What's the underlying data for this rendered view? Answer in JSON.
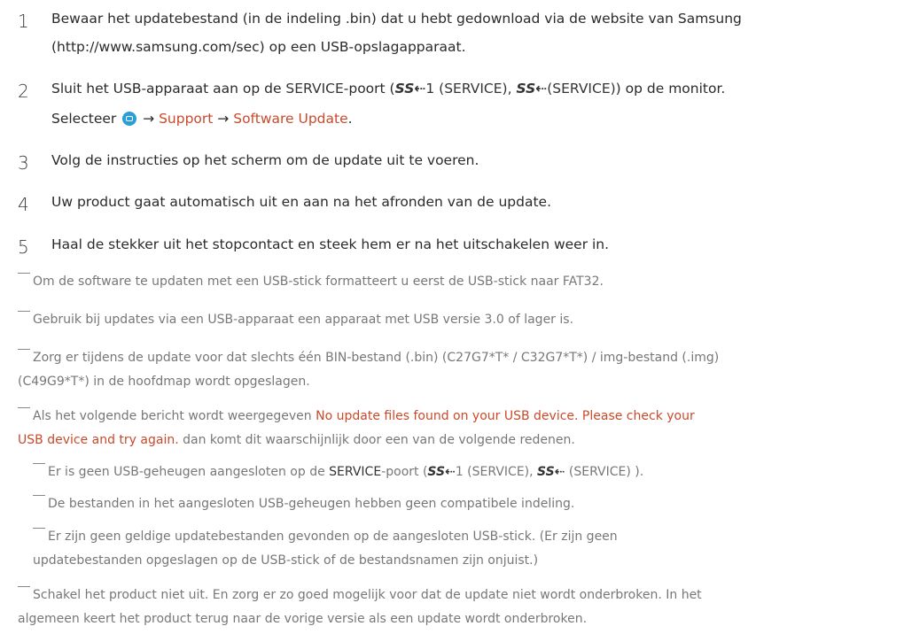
{
  "steps": [
    {
      "num": "1",
      "lines": [
        "Bewaar het updatebestand (in de indeling .bin) dat u hebt gedownload via de website van Samsung",
        "(http://www.samsung.com/sec) op een USB-opslagapparaat."
      ]
    },
    {
      "num": "2",
      "line1_a": "Sluit het USB-apparaat aan op de ",
      "line1_service": "SERVICE",
      "line1_b": "-poort (",
      "usb_symbol": "SS⇠",
      "line1_port1": "1 (SERVICE), ",
      "line1_port2": "(SERVICE)",
      "line1_c": ") op de monitor.",
      "line2_a": "Selecteer ",
      "menu_icon": "menu-icon",
      "arrow": "→",
      "support": "Support",
      "software_update": "Software Update",
      "line2_end": "."
    },
    {
      "num": "3",
      "lines": [
        "Volg de instructies op het scherm om de update uit te voeren."
      ]
    },
    {
      "num": "4",
      "lines": [
        "Uw product gaat automatisch uit en aan na het afronden van de update."
      ]
    },
    {
      "num": "5",
      "lines": [
        "Haal de stekker uit het stopcontact en steek hem er na het uitschakelen weer in."
      ]
    }
  ],
  "notes": {
    "n1": "Om de software te updaten met een USB-stick formatteert u eerst de USB-stick naar FAT32.",
    "n2": "Gebruik bij updates via een USB-apparaat een apparaat met USB versie 3.0 of lager is.",
    "n3": [
      "Zorg er tijdens de update voor dat slechts één BIN-bestand (.bin) (C27G7*T* / C32G7*T*) / img-bestand (.img)",
      "(C49G9*T*) in de hoofdmap wordt opgeslagen."
    ],
    "n4_a": "Als het volgende bericht wordt weergegeven ",
    "n4_msg1": "No update files found on your USB device. Please check your",
    "n4_msg2": "USB device and try again.",
    "n4_b": " dan komt dit waarschijnlijk door een van de volgende redenen.",
    "n4_sub1_a": "Er is geen USB-geheugen aangesloten op de ",
    "n4_sub1_service": "SERVICE",
    "n4_sub1_b": "-poort (",
    "n4_sub1_port1": "1 (SERVICE), ",
    "n4_sub1_port2": " (SERVICE) ).",
    "n4_sub2": "De bestanden in het aangesloten USB-geheugen hebben geen compatibele indeling.",
    "n4_sub3": [
      "Er zijn geen geldige updatebestanden gevonden op de aangesloten USB-stick. (Er zijn geen",
      "updatebestanden opgeslagen op de USB-stick of de bestandsnamen zijn onjuist.)"
    ],
    "n5": [
      "Schakel het product niet uit. En zorg er zo goed mogelijk voor dat de update niet wordt onderbroken. In het",
      "algemeen keert het product terug naar de vorige versie als een update wordt onderbroken."
    ]
  },
  "colors": {
    "accent": "#c94a2b",
    "menu_icon": "#2a9fd6"
  }
}
